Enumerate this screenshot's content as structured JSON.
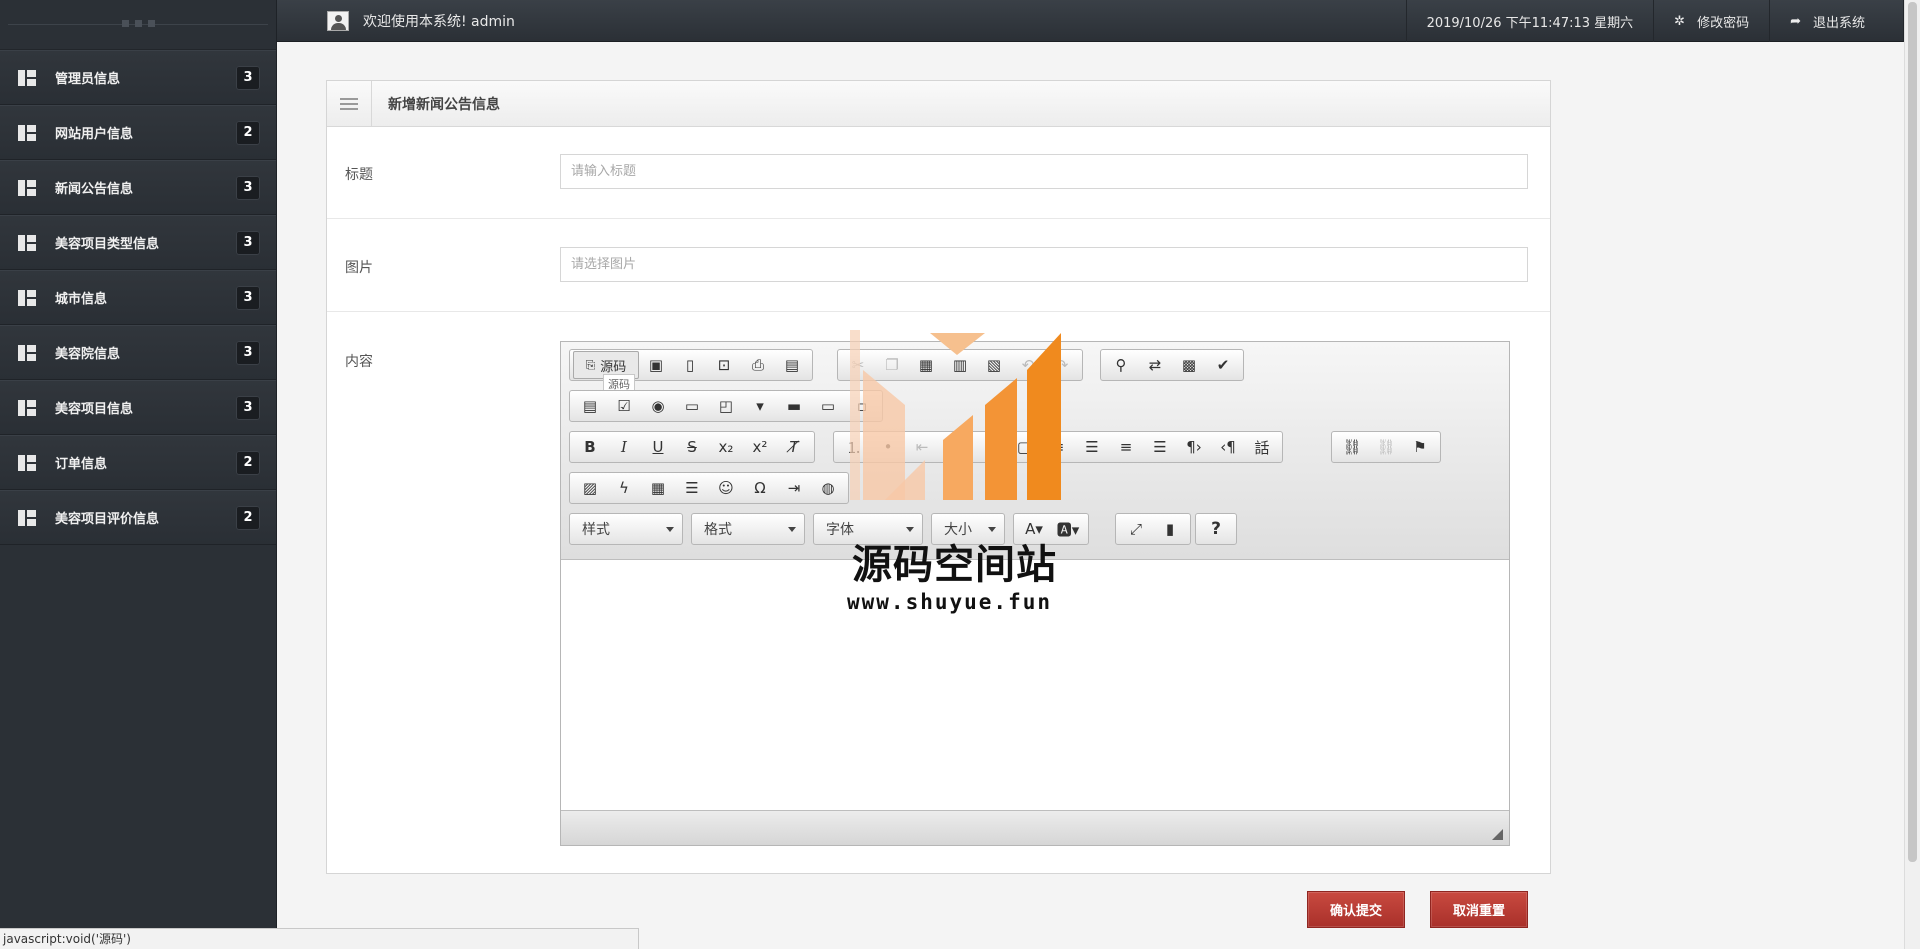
{
  "sidebar": {
    "items": [
      {
        "label": "管理员信息",
        "count": "3"
      },
      {
        "label": "网站用户信息",
        "count": "2"
      },
      {
        "label": "新闻公告信息",
        "count": "3"
      },
      {
        "label": "美容项目类型信息",
        "count": "3"
      },
      {
        "label": "城市信息",
        "count": "3"
      },
      {
        "label": "美容院信息",
        "count": "3"
      },
      {
        "label": "美容项目信息",
        "count": "3"
      },
      {
        "label": "订单信息",
        "count": "2"
      },
      {
        "label": "美容项目评价信息",
        "count": "2"
      }
    ]
  },
  "topbar": {
    "welcome": "欢迎使用本系统! admin",
    "datetime": "2019/10/26 下午11:47:13 星期六",
    "change_password": "修改密码",
    "logout": "退出系统"
  },
  "panel": {
    "title": "新增新闻公告信息"
  },
  "form": {
    "title_label": "标题",
    "title_placeholder": "请输入标题",
    "image_label": "图片",
    "image_placeholder": "请选择图片",
    "content_label": "内容"
  },
  "editor": {
    "source_label": "源码",
    "tooltip": "源码",
    "combo_style": "样式",
    "combo_format": "格式",
    "combo_font": "字体",
    "combo_size": "大小"
  },
  "actions": {
    "submit": "确认提交",
    "reset": "取消重置"
  },
  "statusbar": {
    "text": "javascript:void('源码')"
  },
  "watermark": {
    "name": "源码空间站",
    "url": "www.shuyue.fun"
  },
  "colors": {
    "sidebar_bg": "#2b3036",
    "button_red": "#b8382f",
    "watermark_orange": "#f0952a"
  }
}
